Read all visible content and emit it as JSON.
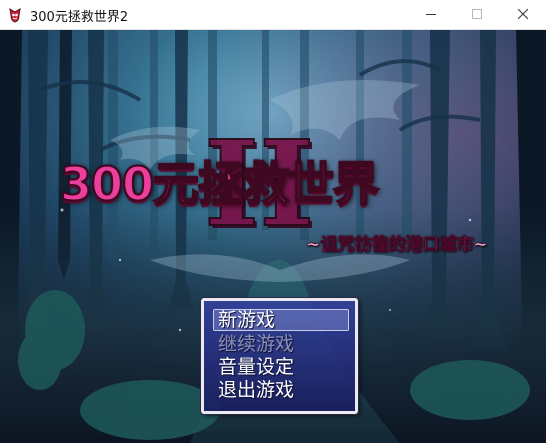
{
  "window": {
    "title": "300元拯救世界2",
    "icon": "game-app-icon",
    "controls": [
      "minimize-icon",
      "maximize-icon",
      "close-icon"
    ]
  },
  "logo": {
    "main_text": "300元拯救世界",
    "numeral": "II",
    "subtitle": "~诅咒彷徨的港口城市~",
    "colors": {
      "main": "#ea3f9a",
      "numeral": "#7a1048",
      "outline": "#3d0820"
    }
  },
  "menu": {
    "items": [
      {
        "label": "新游戏",
        "selected": true,
        "enabled": true
      },
      {
        "label": "继续游戏",
        "selected": false,
        "enabled": false
      },
      {
        "label": "音量设定",
        "selected": false,
        "enabled": true
      },
      {
        "label": "退出游戏",
        "selected": false,
        "enabled": true
      }
    ],
    "colors": {
      "window_top": "#3442a0",
      "window_bottom": "#1a1e60",
      "border": "#e9e9f2",
      "disabled_text": "#8c90b8"
    }
  }
}
